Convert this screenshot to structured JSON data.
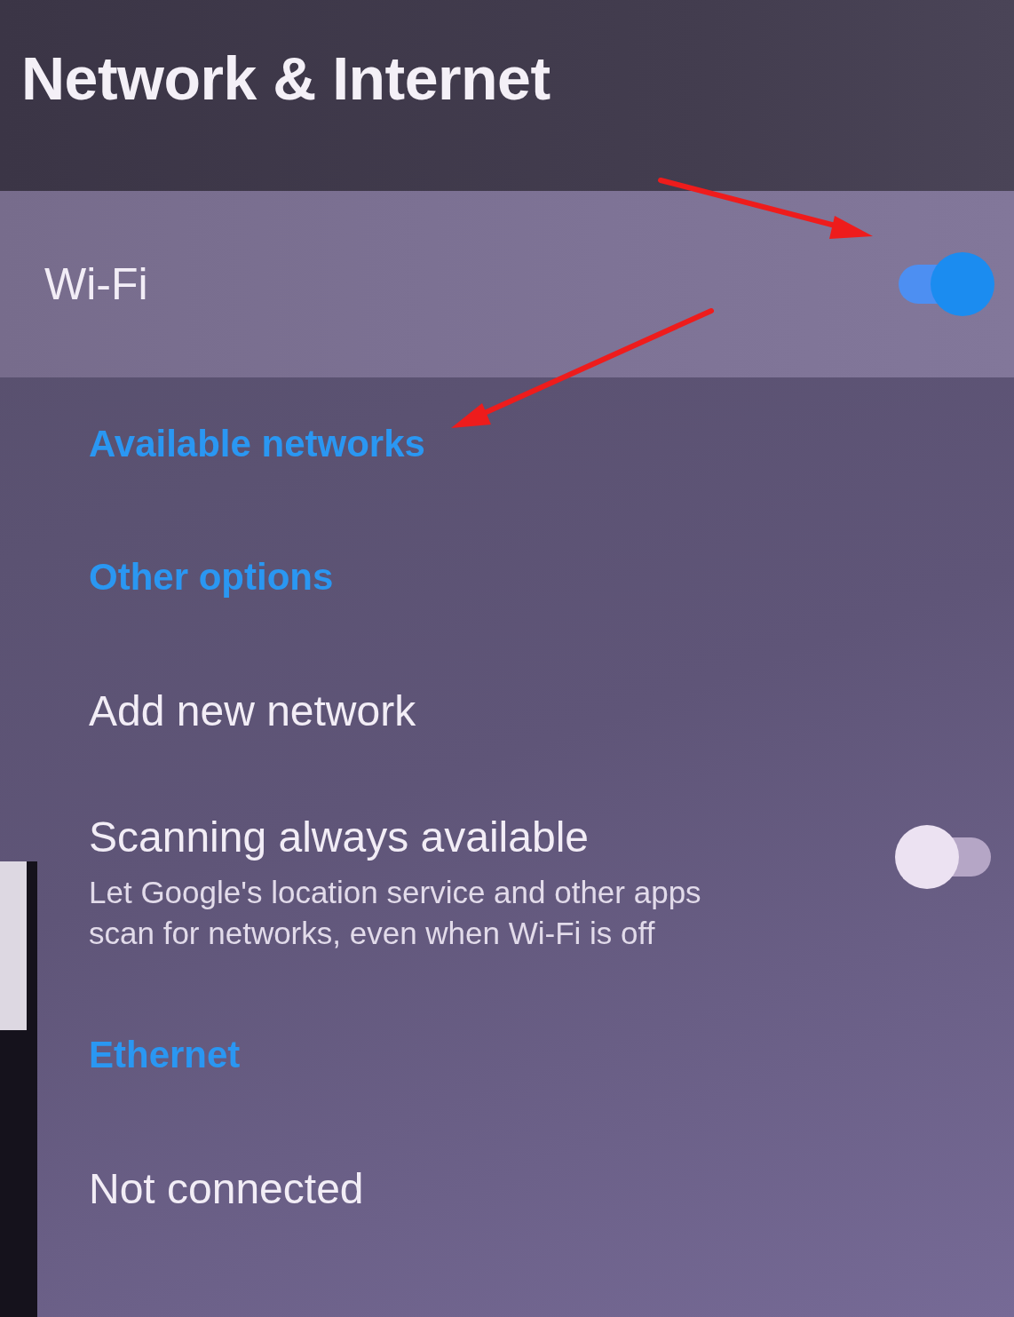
{
  "title": "Network & Internet",
  "items": [
    {
      "kind": "switch",
      "label": "Wi-Fi",
      "on": true,
      "selected": true
    },
    {
      "kind": "header",
      "label": "Available networks"
    },
    {
      "kind": "header",
      "label": "Other options"
    },
    {
      "kind": "action",
      "label": "Add new network",
      "selected": false
    },
    {
      "kind": "switch",
      "label": "Scanning always available",
      "summary": "Let Google's location service and other apps scan for networks, even when Wi-Fi is off",
      "on": false,
      "selected": false
    },
    {
      "kind": "header",
      "label": "Ethernet"
    },
    {
      "kind": "action",
      "label": "Not connected",
      "selected": false
    }
  ]
}
